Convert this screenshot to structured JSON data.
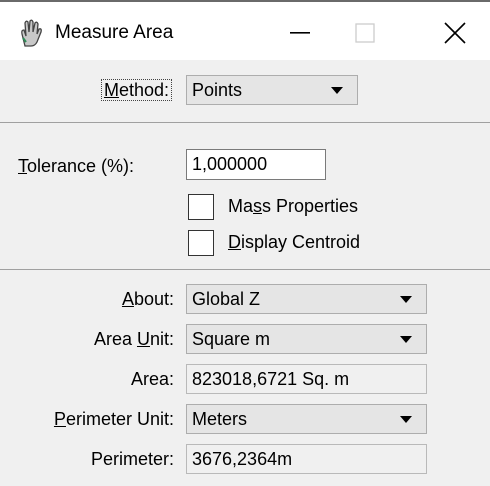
{
  "window": {
    "title": "Measure Area",
    "icon": "measure-area-hand-icon",
    "controls": [
      "minimize-icon",
      "maximize-icon",
      "close-icon"
    ]
  },
  "method": {
    "label_pre": "",
    "label_key": "M",
    "label_post": "ethod:",
    "value": "Points"
  },
  "tolerance": {
    "label_pre": "",
    "label_key": "T",
    "label_post": "olerance (%):",
    "value": "1,000000"
  },
  "mass_properties": {
    "label_pre": "Ma",
    "label_key": "s",
    "label_post": "s Properties",
    "checked": false
  },
  "display_centroid": {
    "label_pre": "",
    "label_key": "D",
    "label_post": "isplay Centroid",
    "checked": false
  },
  "about": {
    "label_pre": "",
    "label_key": "A",
    "label_post": "bout:",
    "value": "Global Z"
  },
  "area_unit": {
    "label_pre": "Area ",
    "label_key": "U",
    "label_post": "nit:",
    "value": "Square m"
  },
  "area": {
    "label": "Area:",
    "value": "823018,6721 Sq. m"
  },
  "perimeter_unit": {
    "label_pre": "",
    "label_key": "P",
    "label_post": "erimeter Unit:",
    "value": "Meters"
  },
  "perimeter": {
    "label": "Perimeter:",
    "value": "3676,2364m"
  },
  "colors": {
    "dialog_background": "#f0f0f0",
    "combo_background": "#e5e5e5",
    "titlebar_background": "#ffffff"
  }
}
